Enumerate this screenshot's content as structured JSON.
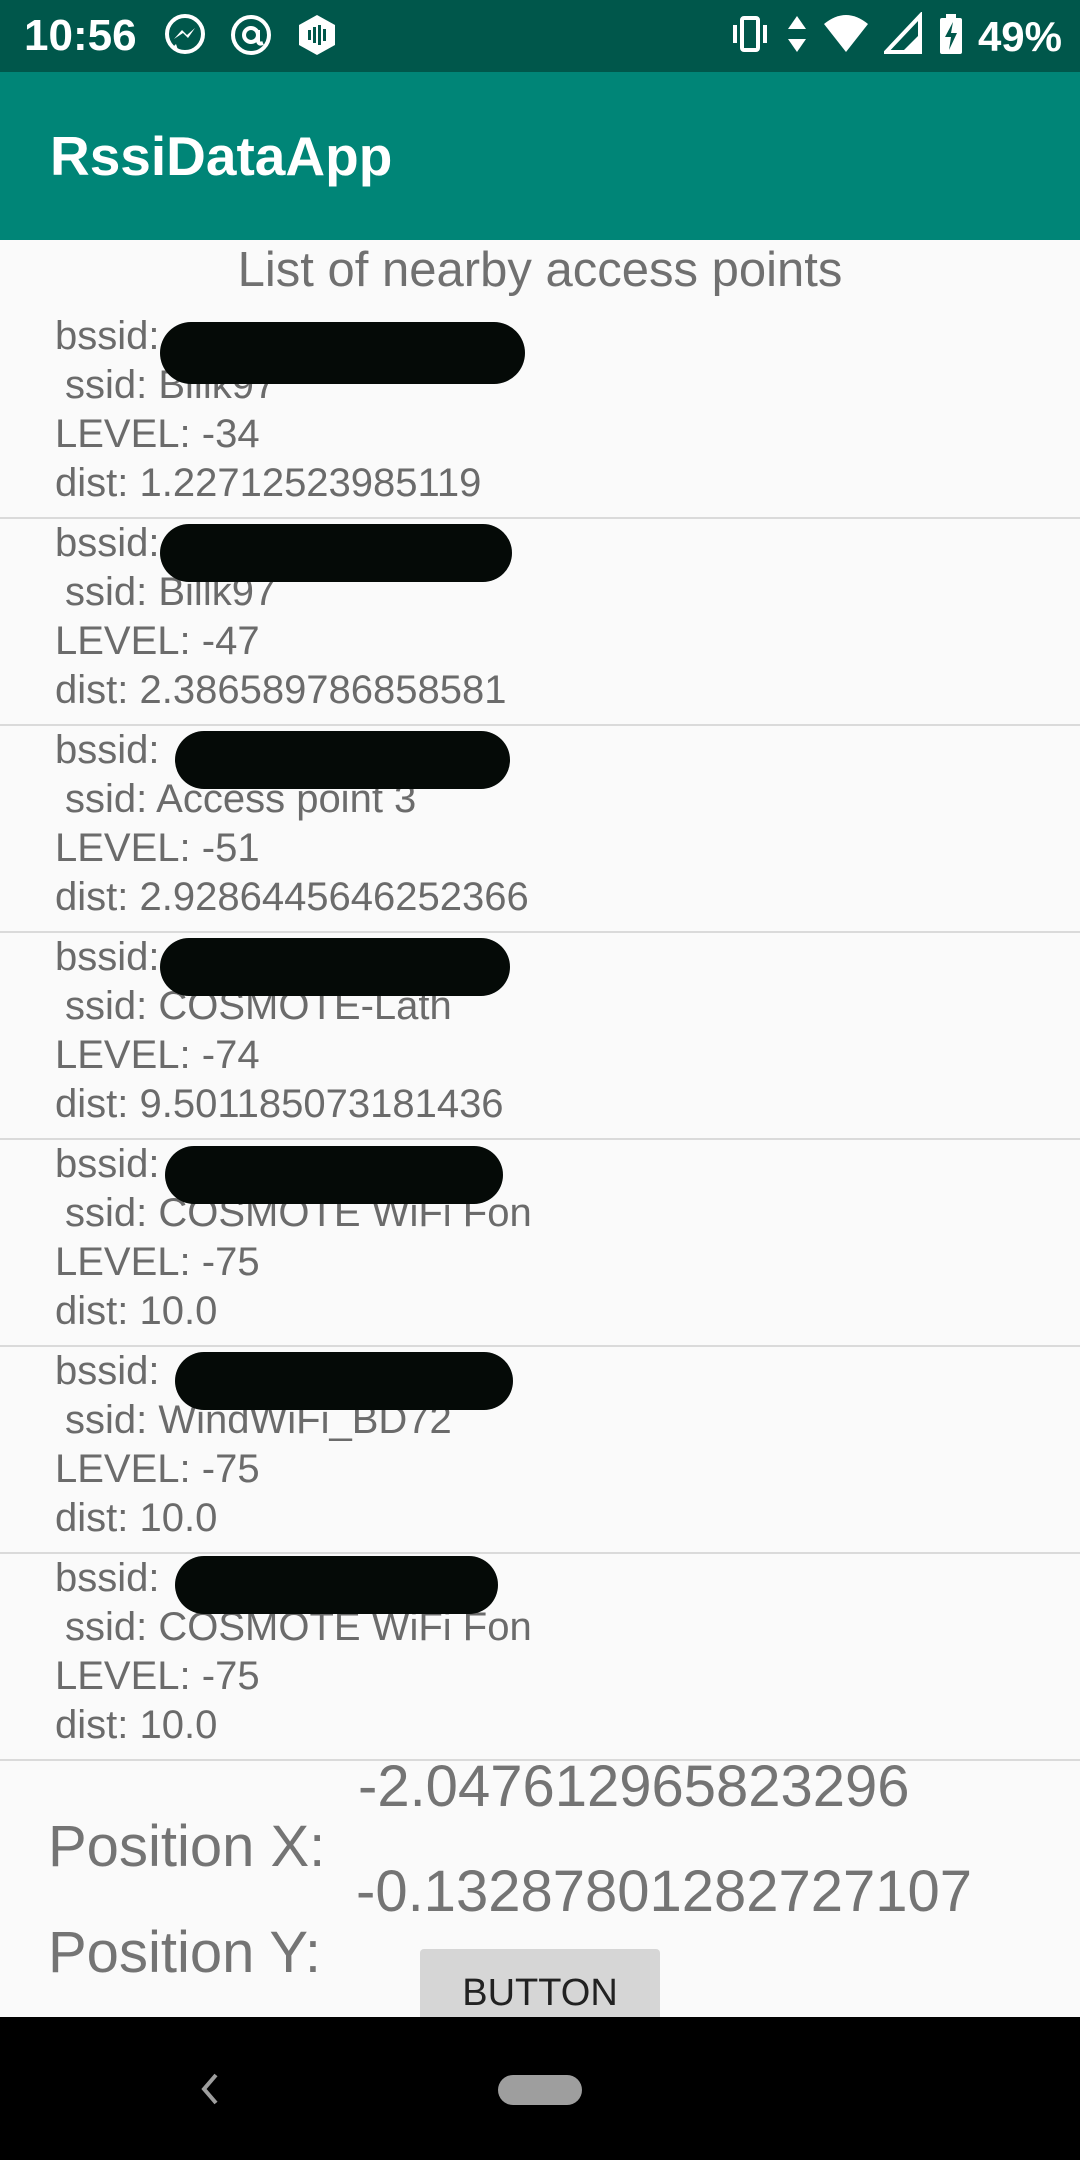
{
  "status_bar": {
    "time": "10:56",
    "battery": "49%",
    "icons_left": [
      "messenger-icon",
      "at-sign-icon",
      "shield-app-icon"
    ],
    "icons_right": [
      "vibrate-icon",
      "data-arrows-icon",
      "wifi-icon",
      "signal-icon",
      "battery-charging-icon"
    ]
  },
  "app_bar": {
    "title": "RssiDataApp"
  },
  "list": {
    "heading": "List of nearby access points",
    "items": [
      {
        "bssid_label": "bssid:",
        "ssid": " ssid: Billk97",
        "level": "LEVEL: -34",
        "dist": "dist: 1.22712523985119"
      },
      {
        "bssid_label": "bssid:",
        "ssid": " ssid: Billk97",
        "level": "LEVEL: -47",
        "dist": "dist: 2.386589786858581"
      },
      {
        "bssid_label": "bssid:",
        "ssid": " ssid: Access point 3",
        "level": "LEVEL: -51",
        "dist": "dist: 2.9286445646252366"
      },
      {
        "bssid_label": "bssid:",
        "ssid": " ssid: COSMOTE-Lath",
        "level": "LEVEL: -74",
        "dist": "dist: 9.501185073181436"
      },
      {
        "bssid_label": "bssid:",
        "ssid": " ssid: COSMOTE WiFi Fon",
        "level": "LEVEL: -75",
        "dist": "dist: 10.0"
      },
      {
        "bssid_label": "bssid:",
        "ssid": " ssid: WindWiFi_BD72",
        "level": "LEVEL: -75",
        "dist": "dist: 10.0"
      },
      {
        "bssid_label": "bssid:",
        "ssid": " ssid: COSMOTE WiFi Fon",
        "level": "LEVEL: -75",
        "dist": "dist: 10.0"
      }
    ]
  },
  "position": {
    "x_label": "Position X:",
    "y_label": "Position Y:",
    "x_value": "-2.047612965823296",
    "y_value": "-0.13287801282727107"
  },
  "button": {
    "label": "BUTTON"
  },
  "nav_bar": {
    "icons": [
      "back-icon",
      "home-pill-icon"
    ]
  },
  "colors": {
    "status_bar": "#00574B",
    "app_bar": "#008577",
    "background": "#FAFAFA",
    "text": "#6B6B6B",
    "redaction": "#050A07"
  }
}
